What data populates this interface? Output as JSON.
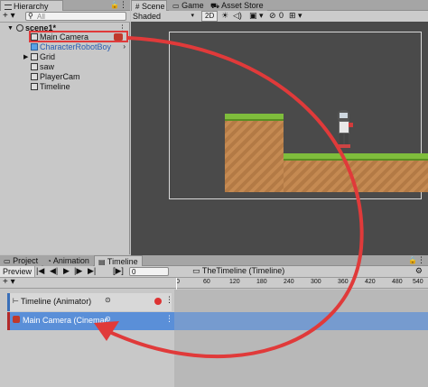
{
  "hierarchy": {
    "tab": "Hierarchy",
    "search_placeholder": "All",
    "scene_name": "scene1*",
    "items": [
      {
        "label": "Main Camera",
        "blue": false
      },
      {
        "label": "CharacterRobotBoy",
        "blue": true
      },
      {
        "label": "Grid",
        "blue": false
      },
      {
        "label": "saw",
        "blue": false
      },
      {
        "label": "PlayerCam",
        "blue": false
      },
      {
        "label": "Timeline",
        "blue": false
      }
    ]
  },
  "scene_view": {
    "tabs": [
      "Scene",
      "Game",
      "Asset Store"
    ],
    "shading": "Shaded",
    "mode_2d": "2D",
    "gizmo_count": "0"
  },
  "bottom": {
    "tabs": [
      "Project",
      "Animation",
      "Timeline"
    ],
    "preview_label": "Preview",
    "frame_value": "0",
    "timeline_title": "TheTimeline (Timeline)",
    "ruler_ticks": [
      "0",
      "60",
      "120",
      "180",
      "240",
      "300",
      "360",
      "420",
      "480",
      "540"
    ],
    "tracks": [
      {
        "label": "Timeline (Animator)"
      },
      {
        "label": "Main Camera (Cinemac"
      }
    ]
  },
  "colors": {
    "highlight_red": "#e03a3a",
    "selection_blue": "#5a8fd8",
    "scene_bg": "#4a4a4a",
    "grass": "#7fbd3c",
    "dirt": "#c58a52"
  },
  "icons": [
    "lock-icon",
    "menu-icon",
    "camera-icon",
    "cube-icon",
    "play-icon",
    "record-icon"
  ]
}
